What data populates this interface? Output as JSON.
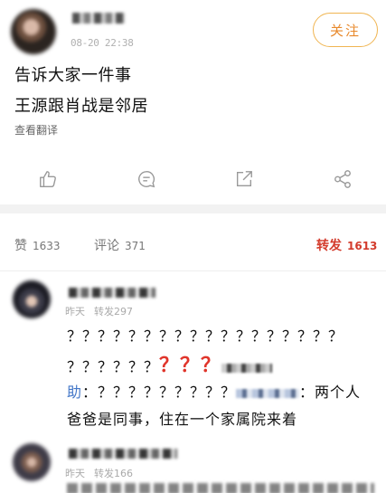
{
  "post": {
    "time": "08-20 22:38",
    "follow_label": "关注",
    "line1": "告诉大家一件事",
    "line2": "王源跟肖战是邻居",
    "translate": "查看翻译"
  },
  "actions": [
    {
      "icon": "thumbs-up-icon"
    },
    {
      "icon": "comment-icon"
    },
    {
      "icon": "repost-icon"
    },
    {
      "icon": "share-icon"
    }
  ],
  "stats": {
    "likes_label": "赞",
    "likes_count": "1633",
    "comments_label": "评论",
    "comments_count": "371",
    "reposts_label": "转发",
    "reposts_count": "1613",
    "active_color": "#d33b2c"
  },
  "comments": [
    {
      "meta_time": "昨天",
      "meta_reposts": "转发297",
      "line1": "？？？？？？？？？？？？？？？？？？",
      "line2_prefix": "？？？？？？",
      "line2_red": "？？？",
      "line3_tag": "助",
      "line3_mid": "：？？？？？？？？？",
      "line3_suffix": "：两个人",
      "line4": "爸爸是同事，住在一个家属院来着"
    },
    {
      "meta_time": "昨天",
      "meta_reposts": "转发166"
    }
  ]
}
